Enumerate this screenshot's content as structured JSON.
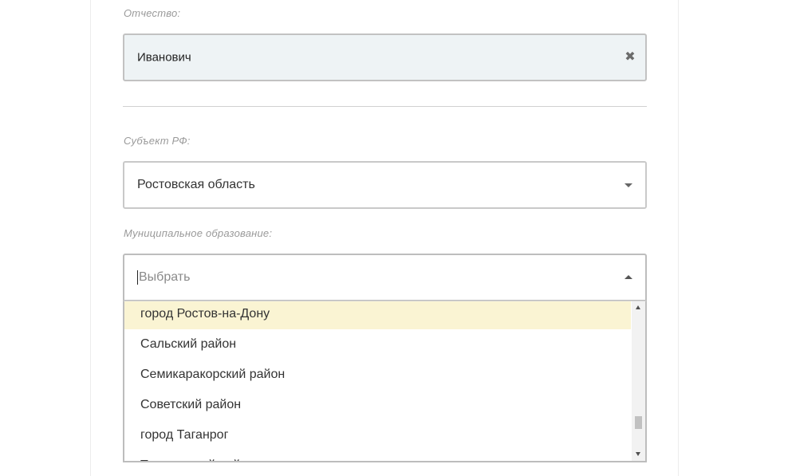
{
  "form": {
    "patronymic": {
      "label": "Отчество:",
      "value": "Иванович",
      "clear_icon": "close-icon"
    },
    "region": {
      "label": "Субъект РФ:",
      "value": "Ростовская область",
      "caret_icon": "chevron-down-icon"
    },
    "municipality": {
      "label": "Муниципальное образование:",
      "placeholder": "Выбрать",
      "caret_icon": "chevron-up-icon",
      "options": [
        "город Ростов-на-Дону",
        "Сальский район",
        "Семикаракорский район",
        "Советский район",
        "город Таганрог",
        "Тарасовский район"
      ],
      "highlighted_index": 0
    }
  },
  "colors": {
    "highlight": "#faf4d3",
    "filled_field_bg": "#eef3f5",
    "border": "#c9c9c9",
    "label": "#9a9a9a"
  }
}
